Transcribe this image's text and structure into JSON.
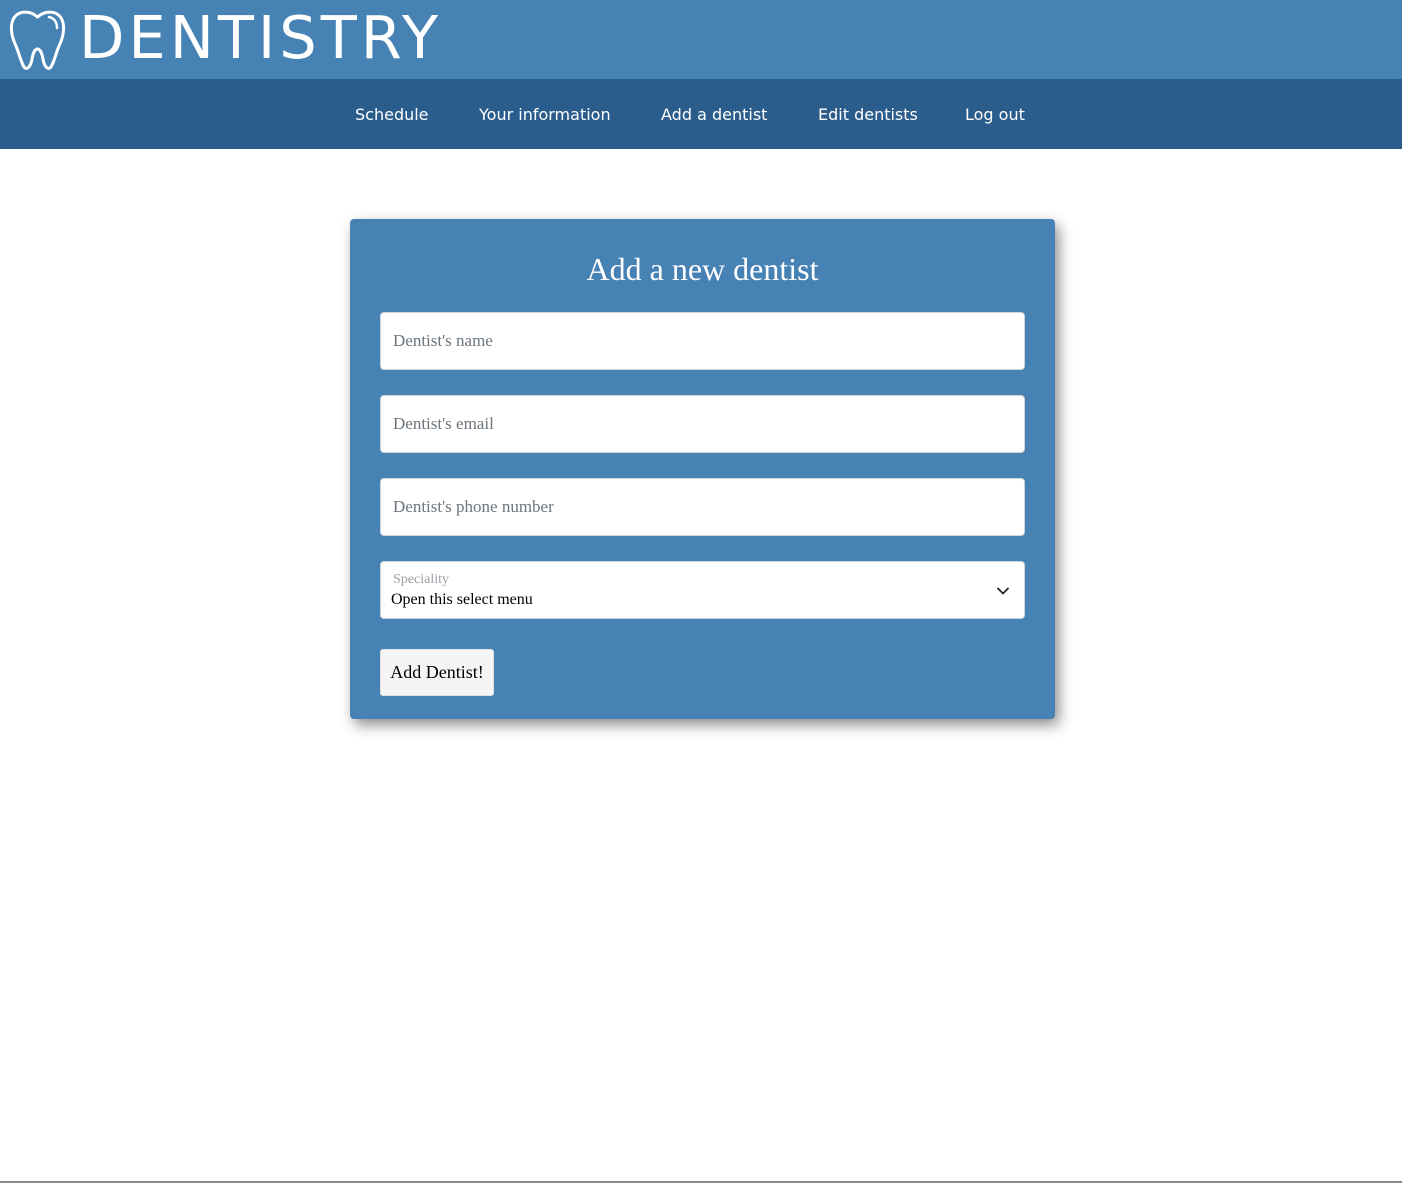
{
  "brand": {
    "logo_icon": "tooth-icon",
    "name": "DENTISTRY"
  },
  "nav": {
    "items": [
      {
        "label": "Schedule"
      },
      {
        "label": "Your information"
      },
      {
        "label": "Add a dentist"
      },
      {
        "label": "Edit dentists"
      },
      {
        "label": "Log out"
      }
    ]
  },
  "form": {
    "title": "Add a new dentist",
    "name_field": {
      "placeholder": "Dentist's name",
      "value": ""
    },
    "email_field": {
      "placeholder": "Dentist's email",
      "value": ""
    },
    "phone_field": {
      "placeholder": "Dentist's phone number",
      "value": ""
    },
    "speciality": {
      "label": "Speciality",
      "selected": "Open this select menu",
      "icon": "chevron-down-icon"
    },
    "submit_label": "Add Dentist!"
  },
  "colors": {
    "header_bg": "#4682b4",
    "nav_bg": "#2a5d8c",
    "card_bg": "#4682b4",
    "text_light": "#ffffff"
  }
}
